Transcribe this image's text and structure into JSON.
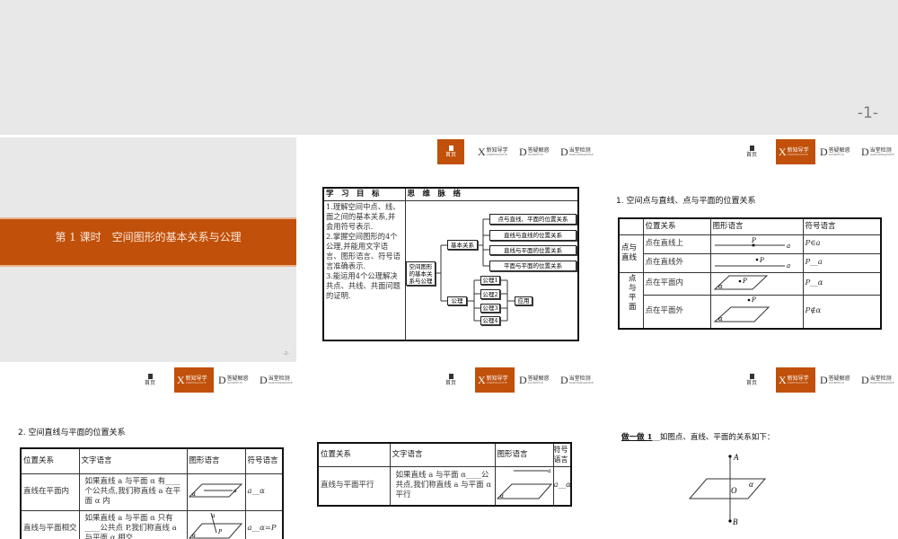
{
  "nav": {
    "home": "首页",
    "items": [
      {
        "letter": "X",
        "label": "新知导学",
        "sub": "XINZHIDAOXUE"
      },
      {
        "letter": "D",
        "label": "答疑解惑",
        "sub": "DAYIJIEHUO"
      },
      {
        "letter": "D",
        "label": "当堂检测",
        "sub": "DANGTANGJIANCE"
      }
    ]
  },
  "slide1": {
    "page": "-1-"
  },
  "slide2": {
    "title": "第 1 课时　空间图形的基本关系与公理",
    "page": "-2-"
  },
  "slide3": {
    "head_left": "学　习　目　标",
    "head_right": "思　维　脉　络",
    "goals": "1.理解空间中点、线、面之间的基本关系,并会用符号表示.\n2.掌握空间图形的4个公理,并能用文字语言、图形语言、符号语言准确表示.\n3.能运用4个公理解决共点、共线、共面问题的证明.",
    "root": "空间图形的基本关系与公理",
    "basic": "基本关系",
    "axiom": "公理",
    "apply": "应用",
    "relations": [
      "点与直线、平面的位置关系",
      "直线与直线的位置关系",
      "直线与平面的位置关系",
      "平面与平面的位置关系"
    ],
    "axioms": [
      "公理1",
      "公理2",
      "公理3",
      "公理4"
    ]
  },
  "slide4": {
    "title": "1. 空间点与直线、点与平面的位置关系",
    "headers": [
      "",
      "位置关系",
      "图形语言",
      "符号语言"
    ],
    "group1": "点与直线",
    "group2": "点与平面",
    "rows": [
      {
        "rel": "点在直线上",
        "sym": "P∈a"
      },
      {
        "rel": "点在直线外",
        "sym": "P__a"
      },
      {
        "rel": "点在平面内",
        "sym": "P__α"
      },
      {
        "rel": "点在平面外",
        "sym": "P∉α"
      }
    ],
    "labels": {
      "P": "P",
      "a": "a",
      "alpha": "α"
    }
  },
  "slide5": {
    "title": "2. 空间直线与平面的位置关系",
    "headers": [
      "位置关系",
      "文字语言",
      "图形语言",
      "符号语言"
    ],
    "rows": [
      {
        "rel": "直线在平面内",
        "text": "如果直线 a 与平面 α 有____个公共点,我们称直线 a 在平面 α 内",
        "sym": "a__α"
      },
      {
        "rel": "直线与平面相交",
        "text": "如果直线 a 与平面 α 只有____公共点 P,我们称直线 a 与平面 α 相交",
        "sym": "a__α=P"
      }
    ]
  },
  "slide6": {
    "headers": [
      "位置关系",
      "文字语言",
      "图形语言",
      "符号语言"
    ],
    "rows": [
      {
        "rel": "直线与平面平行",
        "text": "如果直线 a 与平面 α____公共点,我们称直线 a 与平面 α 平行",
        "sym": "a__α"
      }
    ]
  },
  "slide7": {
    "label": "做一做 1",
    "text": "__如图点、直线、平面的关系如下：",
    "points": {
      "A": "A",
      "B": "B",
      "O": "O",
      "alpha": "α"
    }
  }
}
